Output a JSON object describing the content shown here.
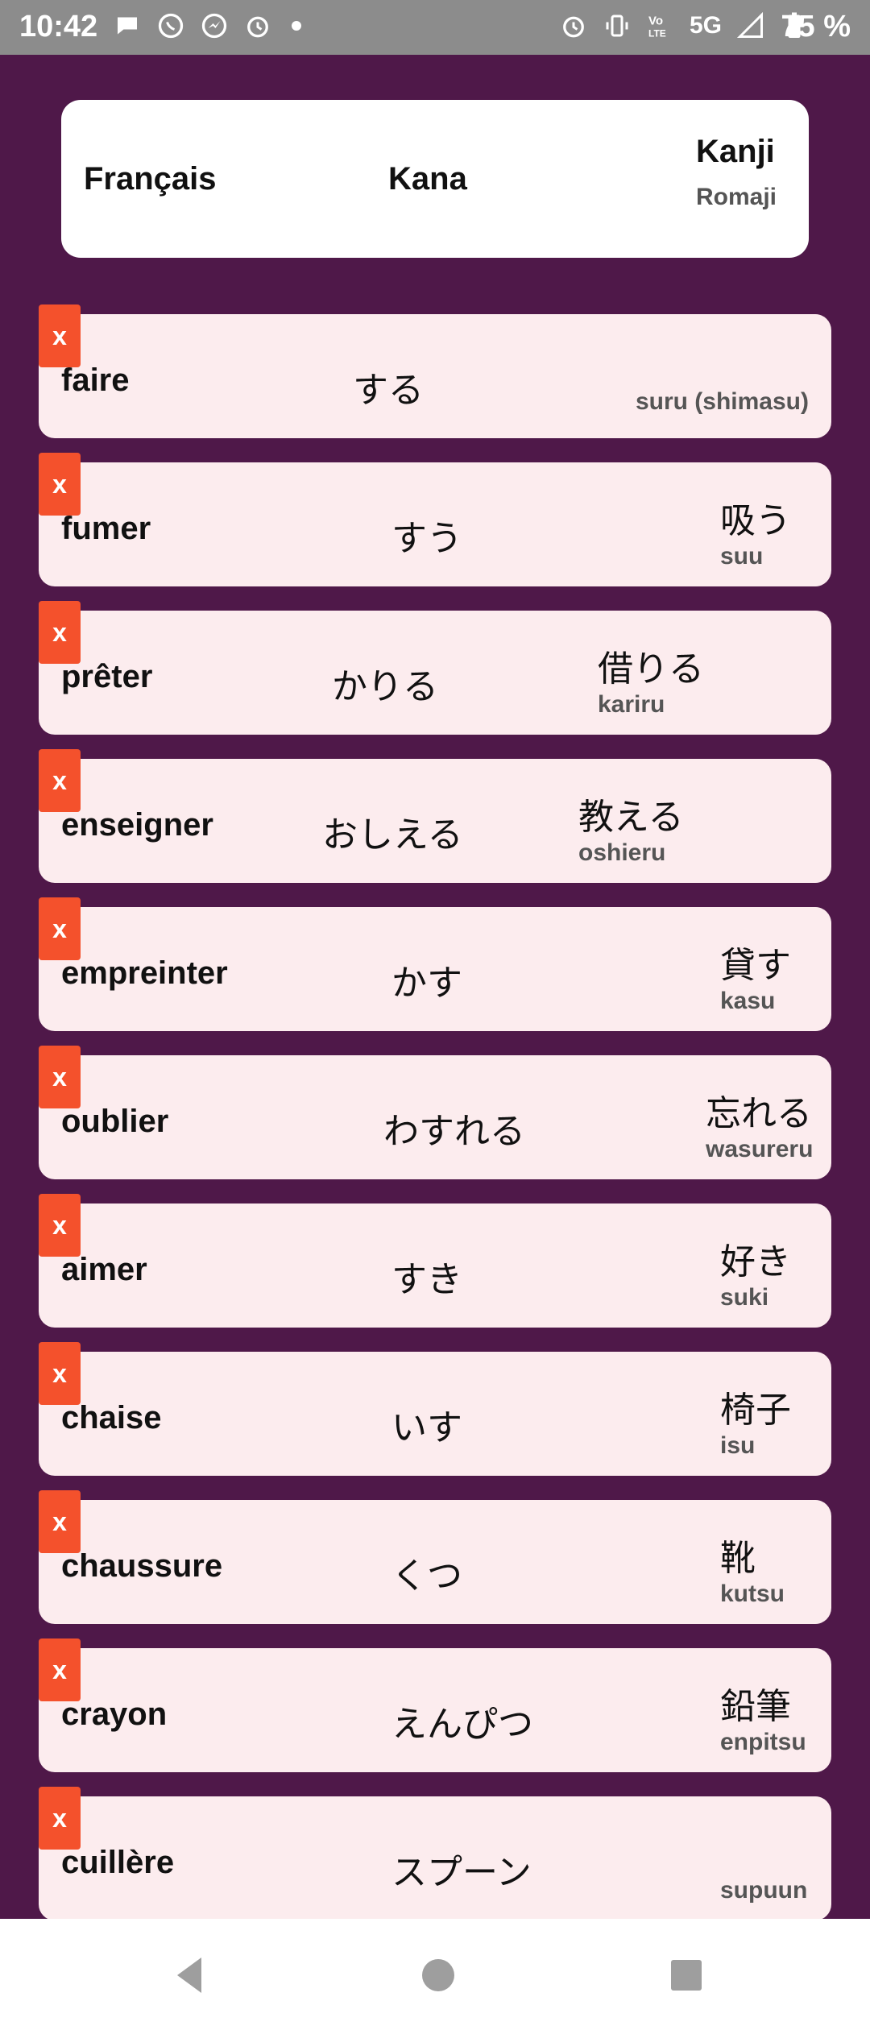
{
  "status_bar": {
    "time": "10:42",
    "network": "5G",
    "battery": "75 %",
    "icons_left": [
      "chat-bubble-icon",
      "whatsapp-icon",
      "messenger-icon",
      "alarm-icon",
      "dot-icon"
    ],
    "icons_right": [
      "alarm-icon",
      "vibrate-icon",
      "volte-icon",
      "signal-icon",
      "battery-icon"
    ]
  },
  "header": {
    "francais": "Français",
    "kana": "Kana",
    "kanji": "Kanji",
    "romaji": "Romaji"
  },
  "delete_label": "x",
  "rows": [
    {
      "francais": "faire",
      "kana": "する",
      "kanji": "",
      "romaji": "suru (shimasu)"
    },
    {
      "francais": "fumer",
      "kana": "すう",
      "kanji": "吸う",
      "romaji": "suu"
    },
    {
      "francais": "prêter",
      "kana": "かりる",
      "kanji": "借りる",
      "romaji": "kariru"
    },
    {
      "francais": "enseigner",
      "kana": "おしえる",
      "kanji": "教える",
      "romaji": "oshieru"
    },
    {
      "francais": "empreinter",
      "kana": "かす",
      "kanji": "貸す",
      "romaji": "kasu"
    },
    {
      "francais": "oublier",
      "kana": "わすれる",
      "kanji": "忘れる",
      "romaji": "wasureru"
    },
    {
      "francais": "aimer",
      "kana": "すき",
      "kanji": "好き",
      "romaji": "suki"
    },
    {
      "francais": "chaise",
      "kana": "いす",
      "kanji": "椅子",
      "romaji": "isu"
    },
    {
      "francais": "chaussure",
      "kana": "くつ",
      "kanji": "靴",
      "romaji": "kutsu"
    },
    {
      "francais": "crayon",
      "kana": "えんぴつ",
      "kanji": "鉛筆",
      "romaji": "enpitsu"
    },
    {
      "francais": "cuillère",
      "kana": "スプーン",
      "kanji": "",
      "romaji": "supuun"
    }
  ],
  "nav": {
    "back": "back-icon",
    "home": "home-icon",
    "recents": "recents-icon"
  },
  "colors": {
    "background": "#4f1849",
    "row_background": "#fcecee",
    "delete_button": "#f4512c",
    "status_bar": "#8c8c8c"
  }
}
